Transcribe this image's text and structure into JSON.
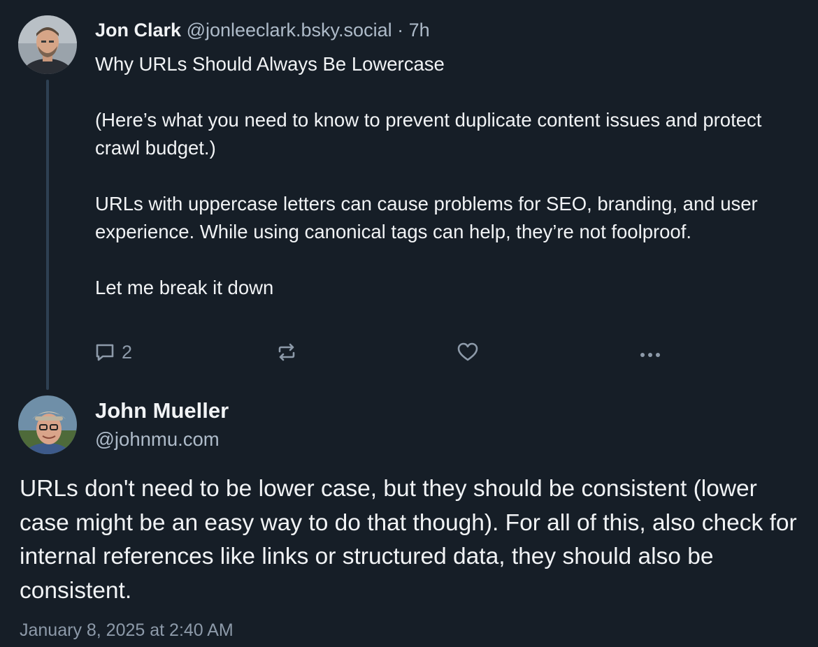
{
  "parent_post": {
    "author_name": "Jon Clark",
    "handle": "@jonleeclark.bsky.social",
    "separator": "·",
    "time": "7h",
    "paragraphs": [
      "Why URLs Should Always Be Lowercase",
      "(Here’s what you need to know to prevent duplicate content issues and protect crawl budget.)",
      "URLs with uppercase letters can cause problems for SEO, branding, and user experience. While using canonical tags can help, they’re not foolproof.",
      "Let me break it down"
    ],
    "actions": {
      "reply_icon": "speech-bubble-icon",
      "reply_count": "2",
      "repost_icon": "repost-arrows-icon",
      "like_icon": "heart-icon",
      "more_icon": "ellipsis-icon"
    }
  },
  "main_post": {
    "author_name": "John Mueller",
    "handle": "@johnmu.com",
    "text": "URLs don't need to be lower case, but they should be consistent (lower case might be an easy way to do that though). For all of this, also check for internal references like links or structured data, they should also be consistent.",
    "timestamp": "January 8, 2025 at 2:40 AM"
  },
  "colors": {
    "background": "#161e27",
    "text_primary": "#f1f3f5",
    "text_secondary": "#aebbc9",
    "icon_muted": "#8d9aa9",
    "thread_line": "#2e4052"
  }
}
